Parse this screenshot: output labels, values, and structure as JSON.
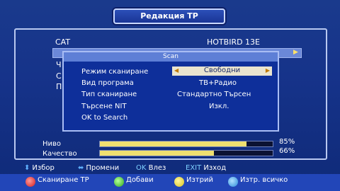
{
  "title": "Редакция TP",
  "main": {
    "sat_label": "CAT",
    "sat_value": "HOTBIRD 13E",
    "partial_labels": [
      "Ч",
      "С",
      "П"
    ]
  },
  "popup": {
    "title": "Scan",
    "rows": [
      {
        "label": "Режим сканиране",
        "value": "Свободни"
      },
      {
        "label": "Вид програма",
        "value": "ТВ+Радио"
      },
      {
        "label": "Тип сканиране",
        "value": "Стандартно Търсен"
      },
      {
        "label": "Търсене NIT",
        "value": "Изкл."
      },
      {
        "label": "OK to Search",
        "value": ""
      }
    ]
  },
  "signal": {
    "level_label": "Ниво",
    "level_percent": 85,
    "level_text": "85%",
    "quality_label": "Качество",
    "quality_percent": 66,
    "quality_text": "66%"
  },
  "help": {
    "select": "Избор",
    "change": "Промени",
    "ok_key": "OK",
    "ok_text": "Влез",
    "exit_key": "EXIT",
    "exit_text": "Изход"
  },
  "buttons": {
    "red": "Сканиране TP",
    "green": "Добави",
    "yellow": "Изтрий",
    "blue": "Изтр. всичко"
  }
}
